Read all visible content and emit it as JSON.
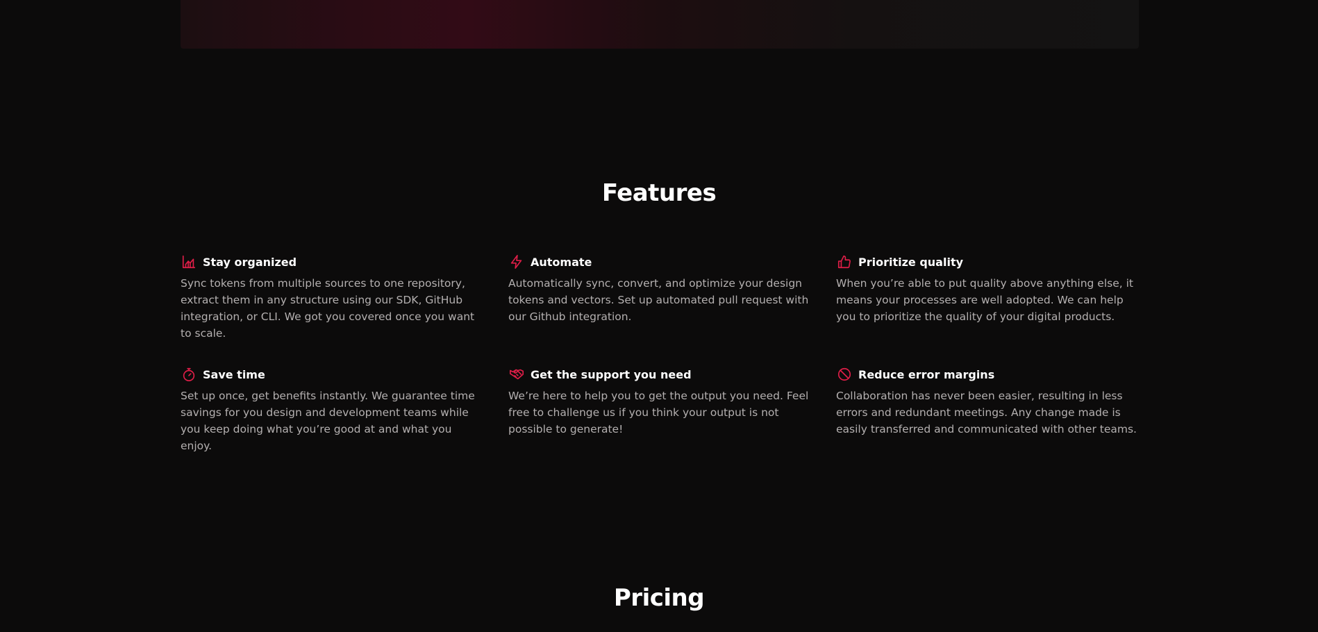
{
  "features": {
    "title": "Features",
    "accent_color": "#e01e48",
    "items": [
      {
        "icon": "chart-area-icon",
        "title": "Stay organized",
        "description": "Sync tokens from multiple sources to one repository, extract them in any structure using our SDK, GitHub integration, or CLI. We got you covered once you want to scale."
      },
      {
        "icon": "bolt-icon",
        "title": "Automate",
        "description": "Automatically sync, convert, and optimize your design tokens and vectors. Set up automated pull request with our Github integration."
      },
      {
        "icon": "thumbs-up-icon",
        "title": "Prioritize quality",
        "description": "When you’re able to put quality above anything else, it means your processes are well adopted. We can help you to prioritize the quality of your digital products."
      },
      {
        "icon": "stopwatch-icon",
        "title": "Save time",
        "description": "Set up once, get benefits instantly. We guarantee time savings for you design and development teams while you keep doing what you’re good at and what you enjoy."
      },
      {
        "icon": "handshake-icon",
        "title": "Get the support you need",
        "description": "We’re here to help you to get the output you need. Feel free to challenge us if you think your output is not possible to generate!"
      },
      {
        "icon": "ban-icon",
        "title": "Reduce error margins",
        "description": "Collaboration has never been easier, resulting in less errors and redundant meetings. Any change made is easily transferred and communicated with other teams."
      }
    ]
  },
  "pricing": {
    "title": "Pricing"
  }
}
